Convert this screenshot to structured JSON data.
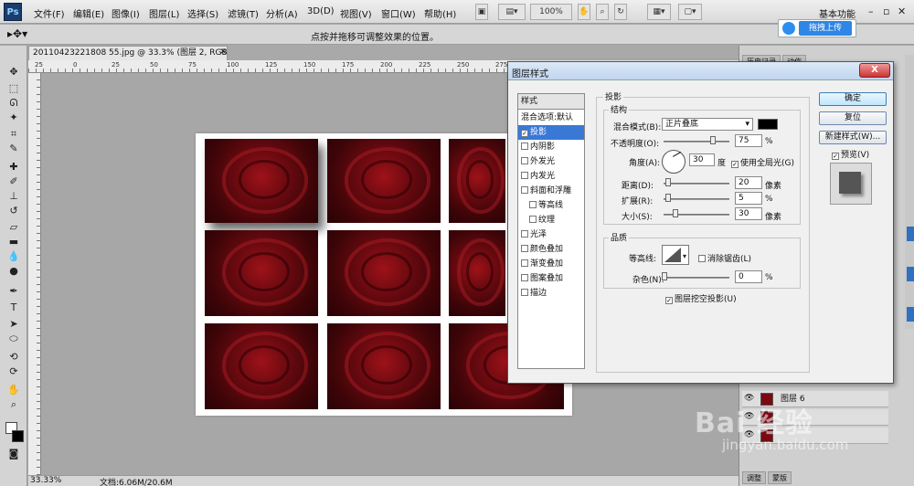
{
  "app": {
    "logo": "Ps",
    "workspace": "基本功能",
    "zoom_select": "100%"
  },
  "menu": [
    "文件(F)",
    "编辑(E)",
    "图像(I)",
    "图层(L)",
    "选择(S)",
    "滤镜(T)",
    "分析(A)",
    "3D(D)",
    "视图(V)",
    "窗口(W)",
    "帮助(H)"
  ],
  "options_bar": {
    "hint": "点按并拖移可调整效果的位置。"
  },
  "baidu": {
    "upload_label": "拖拽上传"
  },
  "document": {
    "tab_title": "20110423221808 55.jpg @ 33.3% (图层 2, RGB/8#) *",
    "close": "×",
    "status_zoom": "33.33%",
    "status_doc": "文档:6.06M/20.6M"
  },
  "ruler_ticks": [
    "25",
    "0",
    "25",
    "50",
    "75",
    "100",
    "125",
    "150",
    "175",
    "200",
    "225",
    "250",
    "275"
  ],
  "dialog": {
    "title": "图层样式",
    "close": "X",
    "style_header": "样式",
    "styles": [
      {
        "label": "混合选项:默认",
        "checkbox": false,
        "checked": false,
        "selected": false,
        "indent": false
      },
      {
        "label": "投影",
        "checkbox": true,
        "checked": true,
        "selected": true,
        "indent": false
      },
      {
        "label": "内阴影",
        "checkbox": true,
        "checked": false,
        "selected": false,
        "indent": false
      },
      {
        "label": "外发光",
        "checkbox": true,
        "checked": false,
        "selected": false,
        "indent": false
      },
      {
        "label": "内发光",
        "checkbox": true,
        "checked": false,
        "selected": false,
        "indent": false
      },
      {
        "label": "斜面和浮雕",
        "checkbox": true,
        "checked": false,
        "selected": false,
        "indent": false
      },
      {
        "label": "等高线",
        "checkbox": true,
        "checked": false,
        "selected": false,
        "indent": true
      },
      {
        "label": "纹理",
        "checkbox": true,
        "checked": false,
        "selected": false,
        "indent": true
      },
      {
        "label": "光泽",
        "checkbox": true,
        "checked": false,
        "selected": false,
        "indent": false
      },
      {
        "label": "颜色叠加",
        "checkbox": true,
        "checked": false,
        "selected": false,
        "indent": false
      },
      {
        "label": "渐变叠加",
        "checkbox": true,
        "checked": false,
        "selected": false,
        "indent": false
      },
      {
        "label": "图案叠加",
        "checkbox": true,
        "checked": false,
        "selected": false,
        "indent": false
      },
      {
        "label": "描边",
        "checkbox": true,
        "checked": false,
        "selected": false,
        "indent": false
      }
    ],
    "section_title": "投影",
    "structure_title": "结构",
    "blend_mode_label": "混合模式(B):",
    "blend_mode_value": "正片叠底",
    "shadow_color": "#000000",
    "opacity_label": "不透明度(O):",
    "opacity_value": "75",
    "percent": "%",
    "angle_label": "角度(A):",
    "angle_value": "30",
    "degree": "度",
    "global_light_label": "使用全局光(G)",
    "global_light_checked": true,
    "distance_label": "距离(D):",
    "distance_value": "20",
    "spread_label": "扩展(R):",
    "spread_value": "5",
    "size_label": "大小(S):",
    "size_value": "30",
    "pixel_unit": "像素",
    "quality_title": "品质",
    "contour_label": "等高线:",
    "antialias_label": "消除锯齿(L)",
    "antialias_checked": false,
    "noise_label": "杂色(N):",
    "noise_value": "0",
    "knockout_label": "图层挖空投影(U)",
    "knockout_checked": true,
    "ok": "确定",
    "reset": "复位",
    "new_style": "新建样式(W)...",
    "preview_label": "预览(V)",
    "preview_checked": true
  },
  "layers": [
    {
      "name": "图层 6"
    }
  ],
  "panel_tabs": [
    "历史记录",
    "动作"
  ],
  "bottom_panel_tabs": [
    "调整",
    "蒙版"
  ],
  "watermark": {
    "brand": "Bai 经验",
    "url": "jingyan.baidu.com"
  },
  "colors": {
    "accent": "#3a78d6",
    "baidu_blue": "#2e86e6",
    "rose": "#7a0a12"
  }
}
